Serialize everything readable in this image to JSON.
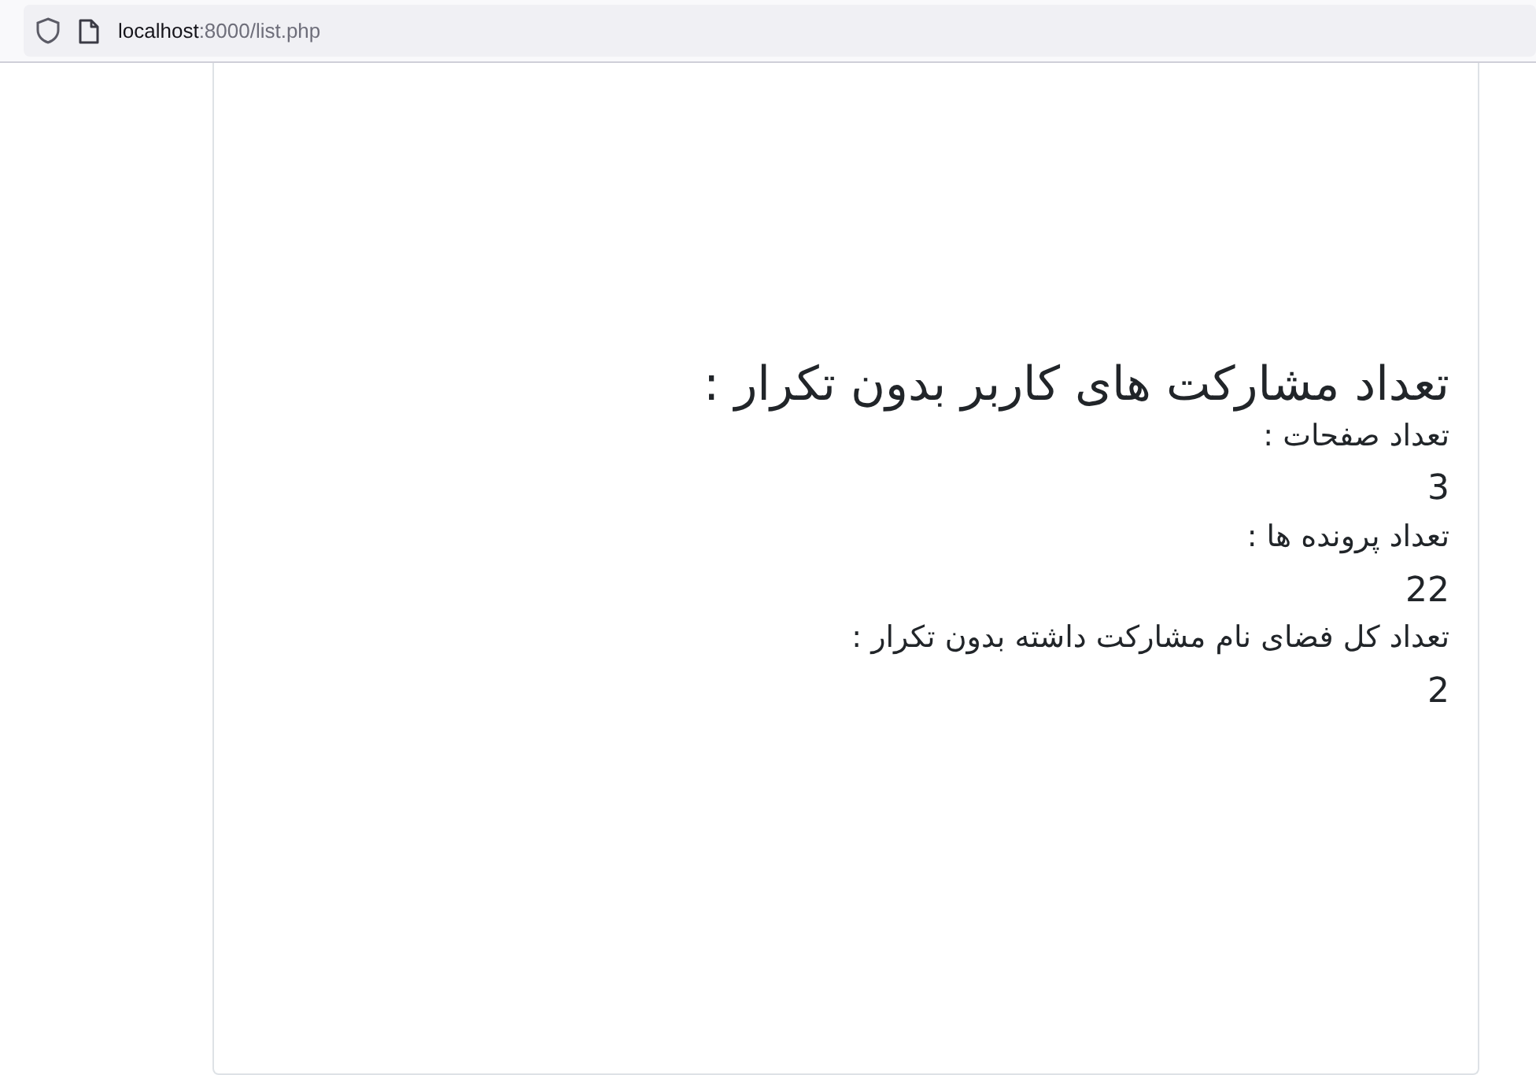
{
  "browser": {
    "url_host": "localhost",
    "url_path": ":8000/list.php"
  },
  "heading": "تعداد مشارکت های کاربر بدون تکرار :",
  "stats": [
    {
      "label": "تعداد صفحات :",
      "value": "3"
    },
    {
      "label": "تعداد پرونده ها :",
      "value": "22"
    },
    {
      "label": "تعداد کل فضای نام مشارکت داشته بدون تکرار :",
      "value": "2"
    }
  ]
}
